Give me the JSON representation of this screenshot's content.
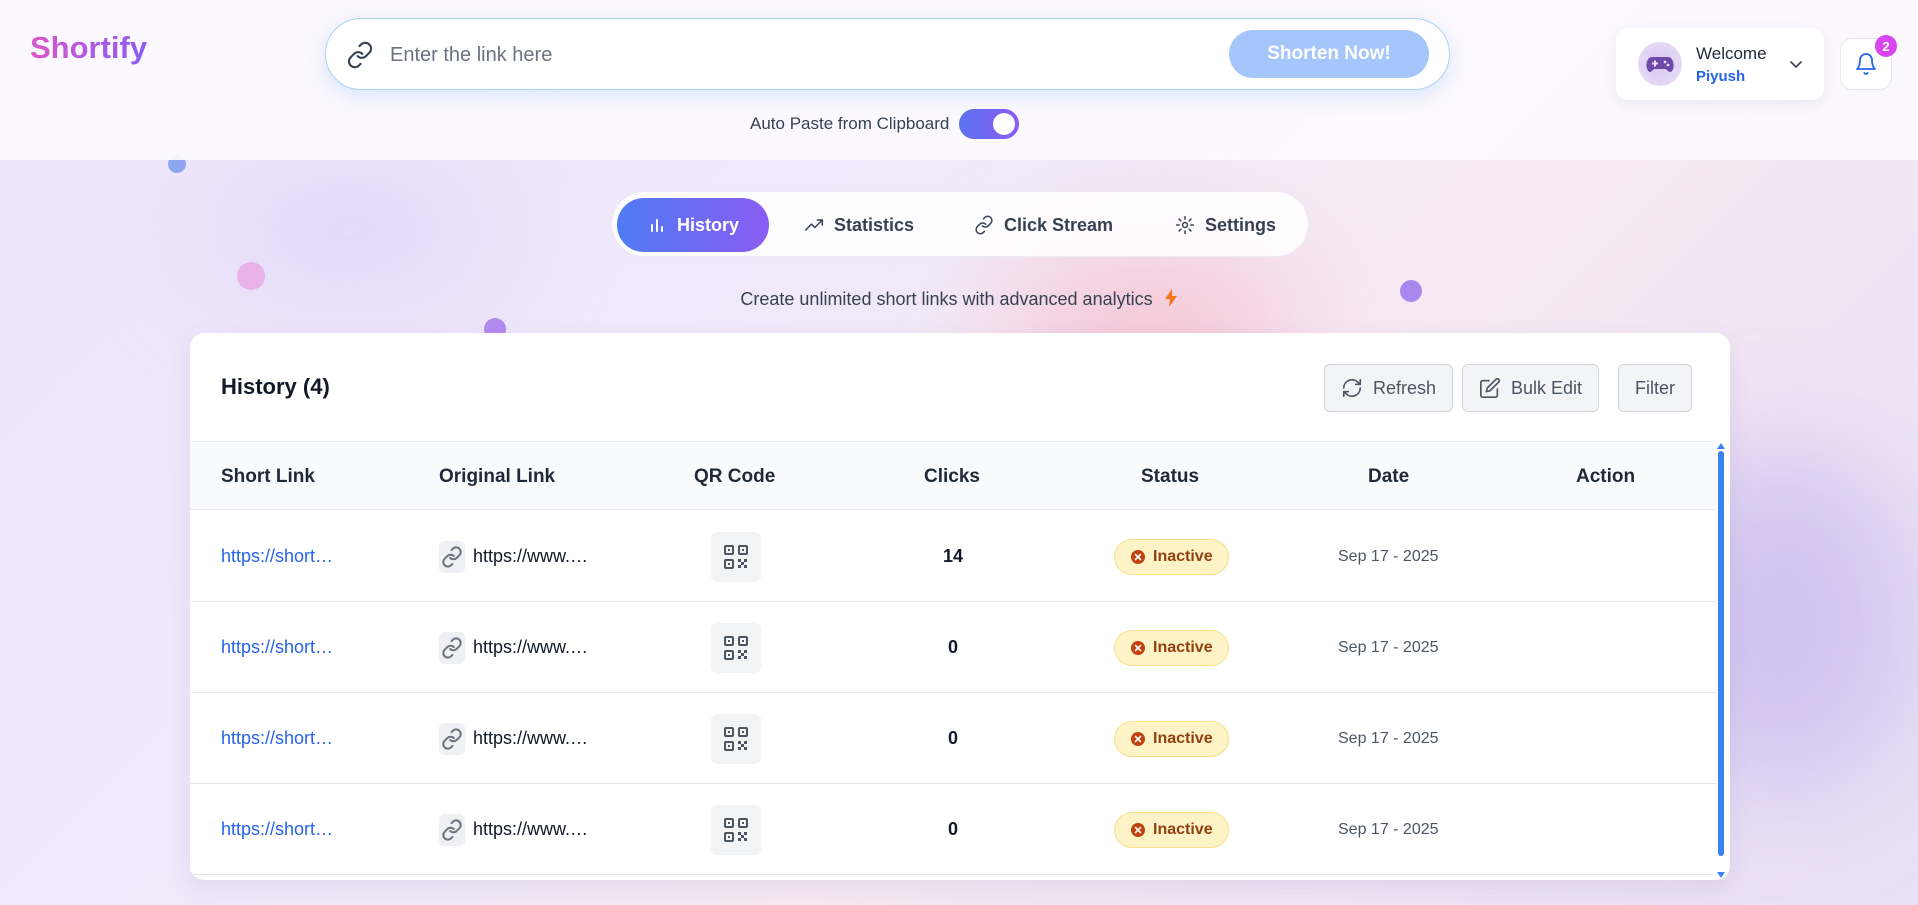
{
  "brand": {
    "name": "Shortify"
  },
  "search": {
    "placeholder": "Enter the link here",
    "value": "",
    "button_label": "Shorten Now!",
    "link_icon": "link-icon"
  },
  "auto_paste": {
    "label": "Auto Paste from Clipboard",
    "enabled": true
  },
  "user": {
    "greeting": "Welcome",
    "name": "Piyush",
    "avatar_icon": "gamepad-icon"
  },
  "notifications": {
    "count": "2",
    "icon": "bell-icon"
  },
  "tabs": [
    {
      "label": "History",
      "icon": "bar-chart-icon",
      "active": true
    },
    {
      "label": "Statistics",
      "icon": "trending-up-icon",
      "active": false
    },
    {
      "label": "Click Stream",
      "icon": "link-icon",
      "active": false
    },
    {
      "label": "Settings",
      "icon": "gear-icon",
      "active": false
    }
  ],
  "tagline": {
    "text": "Create unlimited short links with advanced analytics",
    "icon": "lightning-icon"
  },
  "history": {
    "title": "History (4)",
    "buttons": {
      "refresh": "Refresh",
      "bulk_edit": "Bulk Edit",
      "filter": "Filter"
    },
    "columns": [
      "Short Link",
      "Original Link",
      "QR Code",
      "Clicks",
      "Status",
      "Date",
      "Action"
    ],
    "rows": [
      {
        "short_link": "https://short…",
        "original_link": "https://www.…",
        "clicks": "14",
        "status": "Inactive",
        "date": "Sep 17 - 2025"
      },
      {
        "short_link": "https://short…",
        "original_link": "https://www.…",
        "clicks": "0",
        "status": "Inactive",
        "date": "Sep 17 - 2025"
      },
      {
        "short_link": "https://short…",
        "original_link": "https://www.…",
        "clicks": "0",
        "status": "Inactive",
        "date": "Sep 17 - 2025"
      },
      {
        "short_link": "https://short…",
        "original_link": "https://www.…",
        "clicks": "0",
        "status": "Inactive",
        "date": "Sep 17 - 2025"
      }
    ]
  },
  "colors": {
    "accent_blue": "#2563eb",
    "gradient_start": "#4f7bf5",
    "gradient_end": "#8a5cf3",
    "status_inactive_bg": "#fdf3c7",
    "status_inactive_text": "#92400e"
  }
}
